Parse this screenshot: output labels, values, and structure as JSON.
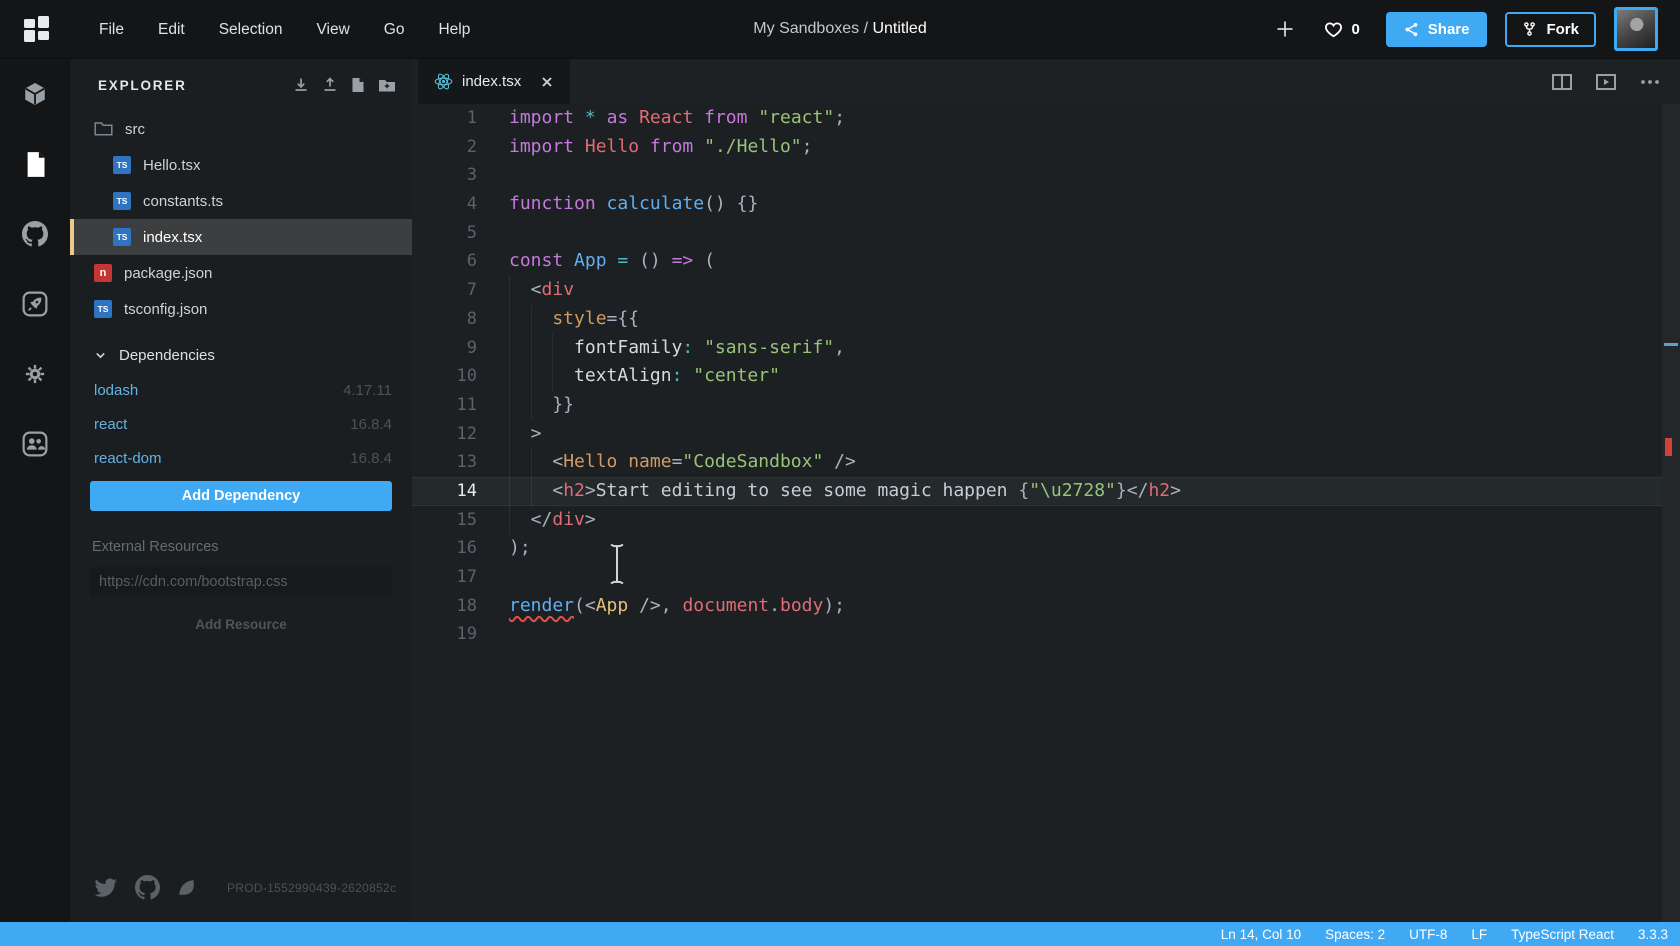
{
  "colors": {
    "accent": "#40A9F3",
    "statusbar": "#40A9F3",
    "selected_file_accent": "#EDC98C",
    "error": "#D6403C"
  },
  "topbar": {
    "menu": [
      "File",
      "Edit",
      "Selection",
      "View",
      "Go",
      "Help"
    ],
    "breadcrumb_path": "My Sandboxes / ",
    "breadcrumb_name": "Untitled",
    "likes_count": "0",
    "share_label": "Share",
    "fork_label": "Fork"
  },
  "activitybar": {
    "items": [
      {
        "icon": "cube-icon",
        "active": false
      },
      {
        "icon": "file-icon",
        "active": true
      },
      {
        "icon": "github-icon",
        "active": false
      },
      {
        "icon": "rocket-icon",
        "active": false
      },
      {
        "icon": "gear-icon",
        "active": false
      },
      {
        "icon": "people-icon",
        "active": false
      }
    ]
  },
  "explorer": {
    "title": "EXPLORER",
    "actions": [
      "download-icon",
      "upload-icon",
      "new-file-icon",
      "new-folder-icon"
    ],
    "badges": {
      "ts": "TS",
      "npm": "n"
    },
    "tree": [
      {
        "label": "src",
        "icon": "folder",
        "level": 0,
        "selected": false
      },
      {
        "label": "Hello.tsx",
        "icon": "ts",
        "level": 1,
        "selected": false
      },
      {
        "label": "constants.ts",
        "icon": "ts",
        "level": 1,
        "selected": false
      },
      {
        "label": "index.tsx",
        "icon": "ts",
        "level": 1,
        "selected": true
      },
      {
        "label": "package.json",
        "icon": "npm",
        "level": 0,
        "selected": false
      },
      {
        "label": "tsconfig.json",
        "icon": "ts",
        "level": 0,
        "selected": false
      }
    ],
    "dependencies": {
      "title": "Dependencies",
      "items": [
        {
          "name": "lodash",
          "version": "4.17.11"
        },
        {
          "name": "react",
          "version": "16.8.4"
        },
        {
          "name": "react-dom",
          "version": "16.8.4"
        }
      ],
      "add_button": "Add Dependency"
    },
    "external_resources": {
      "title": "External Resources",
      "placeholder": "https://cdn.com/bootstrap.css",
      "add_button": "Add Resource"
    },
    "footer": {
      "social": [
        "twitter-icon",
        "github-social-icon",
        "spectrum-icon"
      ],
      "build_id": "PROD-1552990439-2620852c"
    }
  },
  "editor": {
    "tab": {
      "label": "index.tsx",
      "icon": "react-icon"
    },
    "actions": [
      "split-view-icon",
      "open-preview-icon",
      "more-icon"
    ],
    "active_line": 14,
    "lines": [
      {
        "n": 1,
        "indent": 0,
        "tokens": [
          [
            "import",
            "kw"
          ],
          [
            " ",
            "pl"
          ],
          [
            "*",
            "op"
          ],
          [
            " ",
            "pl"
          ],
          [
            "as",
            "kw"
          ],
          [
            " ",
            "pl"
          ],
          [
            "React",
            "var"
          ],
          [
            " ",
            "pl"
          ],
          [
            "from",
            "kw"
          ],
          [
            " ",
            "pl"
          ],
          [
            "\"react\"",
            "str"
          ],
          [
            ";",
            "pl"
          ]
        ]
      },
      {
        "n": 2,
        "indent": 0,
        "tokens": [
          [
            "import",
            "kw"
          ],
          [
            " ",
            "pl"
          ],
          [
            "Hello",
            "var"
          ],
          [
            " ",
            "pl"
          ],
          [
            "from",
            "kw"
          ],
          [
            " ",
            "pl"
          ],
          [
            "\"./Hello\"",
            "str"
          ],
          [
            ";",
            "pl"
          ]
        ]
      },
      {
        "n": 3,
        "indent": 0,
        "tokens": []
      },
      {
        "n": 4,
        "indent": 0,
        "tokens": [
          [
            "function",
            "kw"
          ],
          [
            " ",
            "pl"
          ],
          [
            "calculate",
            "fn"
          ],
          [
            "() {}",
            "pl"
          ]
        ]
      },
      {
        "n": 5,
        "indent": 0,
        "tokens": []
      },
      {
        "n": 6,
        "indent": 0,
        "tokens": [
          [
            "const",
            "kw"
          ],
          [
            " ",
            "pl"
          ],
          [
            "App",
            "fn"
          ],
          [
            " ",
            "pl"
          ],
          [
            "=",
            "op"
          ],
          [
            " () ",
            "pl"
          ],
          [
            "=>",
            "kw"
          ],
          [
            " (",
            "pl"
          ]
        ]
      },
      {
        "n": 7,
        "indent": 1,
        "tokens": [
          [
            "<",
            "pl"
          ],
          [
            "div",
            "var"
          ]
        ]
      },
      {
        "n": 8,
        "indent": 2,
        "tokens": [
          [
            "style",
            "attr"
          ],
          [
            "={{",
            "pl"
          ]
        ]
      },
      {
        "n": 9,
        "indent": 3,
        "tokens": [
          [
            "fontFamily",
            "prop"
          ],
          [
            ":",
            "op"
          ],
          [
            " ",
            "pl"
          ],
          [
            "\"sans-serif\"",
            "str"
          ],
          [
            ",",
            "pl"
          ]
        ]
      },
      {
        "n": 10,
        "indent": 3,
        "tokens": [
          [
            "textAlign",
            "prop"
          ],
          [
            ":",
            "op"
          ],
          [
            " ",
            "pl"
          ],
          [
            "\"center\"",
            "str"
          ]
        ]
      },
      {
        "n": 11,
        "indent": 2,
        "tokens": [
          [
            "}}",
            "pl"
          ]
        ]
      },
      {
        "n": 12,
        "indent": 1,
        "tokens": [
          [
            ">",
            "pl"
          ]
        ]
      },
      {
        "n": 13,
        "indent": 2,
        "tokens": [
          [
            "<",
            "pl"
          ],
          [
            "Hello",
            "attr"
          ],
          [
            " ",
            "pl"
          ],
          [
            "name",
            "attr"
          ],
          [
            "=",
            "pl"
          ],
          [
            "\"CodeSandbox\"",
            "str"
          ],
          [
            " ",
            "pl"
          ],
          [
            "/>",
            "pl"
          ]
        ]
      },
      {
        "n": 14,
        "indent": 2,
        "tokens": [
          [
            "<",
            "pl"
          ],
          [
            "h2",
            "var"
          ],
          [
            ">",
            "pl"
          ],
          [
            "Start editing to see some magic happen ",
            "txt"
          ],
          [
            "{",
            "pl"
          ],
          [
            "\"\\u2728\"",
            "str"
          ],
          [
            "}",
            "pl"
          ],
          [
            "</",
            "pl"
          ],
          [
            "h2",
            "var"
          ],
          [
            ">",
            "pl"
          ]
        ]
      },
      {
        "n": 15,
        "indent": 1,
        "tokens": [
          [
            "</",
            "pl"
          ],
          [
            "div",
            "var"
          ],
          [
            ">",
            "pl"
          ]
        ]
      },
      {
        "n": 16,
        "indent": 0,
        "tokens": [
          [
            ");",
            "pl"
          ]
        ]
      },
      {
        "n": 17,
        "indent": 0,
        "tokens": []
      },
      {
        "n": 18,
        "indent": 0,
        "tokens": [
          [
            "render",
            "fn err"
          ],
          [
            "(<",
            "pl"
          ],
          [
            "App",
            "comp"
          ],
          [
            " ",
            "pl"
          ],
          [
            "/>,",
            "pl"
          ],
          [
            " ",
            "pl"
          ],
          [
            "document",
            "var"
          ],
          [
            ".",
            "pl"
          ],
          [
            "body",
            "var"
          ],
          [
            ");",
            "pl"
          ]
        ]
      },
      {
        "n": 19,
        "indent": 0,
        "tokens": []
      }
    ]
  },
  "statusbar": {
    "items": [
      "Ln 14, Col 10",
      "Spaces: 2",
      "UTF-8",
      "LF",
      "TypeScript React",
      "3.3.3"
    ]
  }
}
